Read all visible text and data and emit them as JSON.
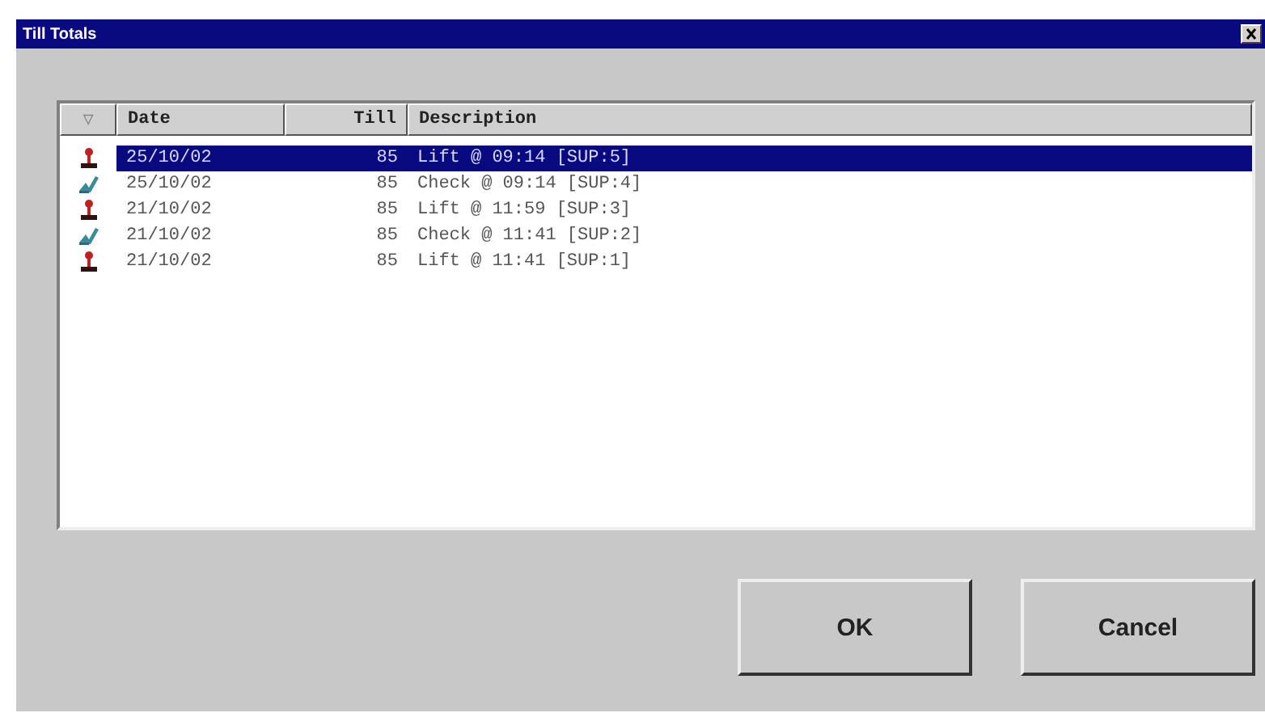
{
  "window": {
    "title": "Till Totals"
  },
  "table": {
    "sort_mark": "▽",
    "columns": [
      "Date",
      "Till",
      "Description"
    ],
    "rows": [
      {
        "kind": "lift",
        "selected": true,
        "cells": [
          "25/10/02",
          "85",
          "Lift @ 09:14 [SUP:5]"
        ]
      },
      {
        "kind": "check",
        "selected": false,
        "cells": [
          "25/10/02",
          "85",
          "Check @ 09:14 [SUP:4]"
        ]
      },
      {
        "kind": "lift",
        "selected": false,
        "cells": [
          "21/10/02",
          "85",
          "Lift @ 11:59 [SUP:3]"
        ]
      },
      {
        "kind": "check",
        "selected": false,
        "cells": [
          "21/10/02",
          "85",
          "Check @ 11:41 [SUP:2]"
        ]
      },
      {
        "kind": "lift",
        "selected": false,
        "cells": [
          "21/10/02",
          "85",
          "Lift @ 11:41 [SUP:1]"
        ]
      }
    ]
  },
  "buttons": [
    "OK",
    "Cancel"
  ]
}
